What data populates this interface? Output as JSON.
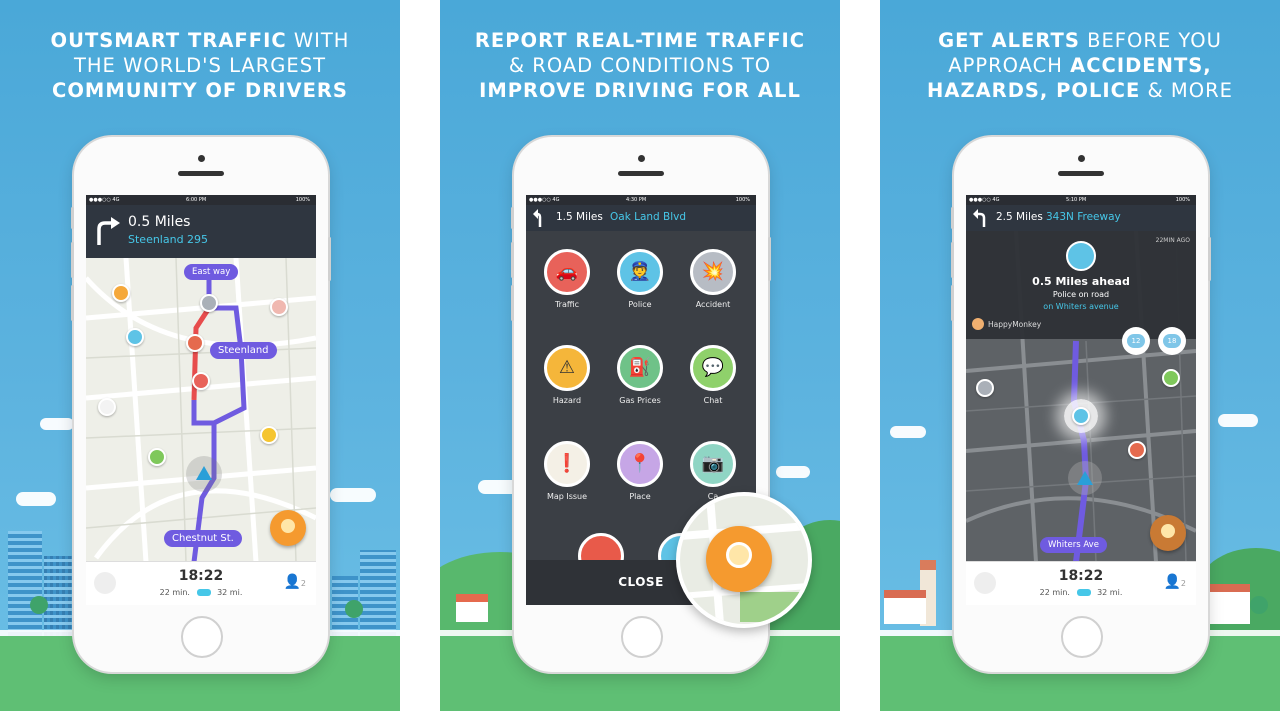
{
  "panels": [
    {
      "headline": [
        [
          {
            "t": "OUTSMART TRAFFIC",
            "b": true
          },
          {
            "t": " WITH",
            "b": false
          }
        ],
        [
          {
            "t": "THE WORLD'S LARGEST",
            "b": false
          }
        ],
        [
          {
            "t": "COMMUNITY OF DRIVERS",
            "b": true
          }
        ]
      ],
      "status": {
        "carrier": "●●●○○ 4G",
        "time": "6:00 PM",
        "battery": "100%"
      },
      "nav": {
        "distance": "0.5 Miles",
        "street": "Steenland 295"
      },
      "map_labels": {
        "east_way": "East way",
        "steenland": "Steenland",
        "chestnut": "Chestnut St."
      },
      "bottom": {
        "eta": "18:22",
        "minutes": "22 min.",
        "miles": "32 mi.",
        "count": "2"
      }
    },
    {
      "headline": [
        [
          {
            "t": "REPORT REAL-TIME TRAFFIC",
            "b": true
          }
        ],
        [
          {
            "t": "& ROAD CONDITIONS TO",
            "b": false
          }
        ],
        [
          {
            "t": "IMPROVE DRIVING FOR ALL",
            "b": true
          }
        ]
      ],
      "status": {
        "carrier": "●●●○○ 4G",
        "time": "4:30 PM",
        "battery": "100%"
      },
      "nav": {
        "distance": "1.5 Miles",
        "street": "Oak Land Blvd"
      },
      "reports": [
        {
          "label": "Traffic",
          "color": "#e8625a",
          "icon": "traffic-icon",
          "glyph": "🚗"
        },
        {
          "label": "Police",
          "color": "#5ec3e6",
          "icon": "police-icon",
          "glyph": "👮"
        },
        {
          "label": "Accident",
          "color": "#b7bcc4",
          "icon": "accident-icon",
          "glyph": "💥"
        },
        {
          "label": "Hazard",
          "color": "#f5b63a",
          "icon": "hazard-icon",
          "glyph": "⚠"
        },
        {
          "label": "Gas Prices",
          "color": "#6fc288",
          "icon": "gas-pump-icon",
          "glyph": "⛽"
        },
        {
          "label": "Chat",
          "color": "#8fd16b",
          "icon": "chat-icon",
          "glyph": "💬"
        },
        {
          "label": "Map Issue",
          "color": "#f4f0e6",
          "icon": "map-issue-icon",
          "glyph": "❗"
        },
        {
          "label": "Place",
          "color": "#c6a6e6",
          "icon": "place-icon",
          "glyph": "📍"
        },
        {
          "label": "Ca",
          "color": "#8fd5c4",
          "icon": "camera-icon",
          "glyph": "📷"
        }
      ],
      "close_label": "CLOSE"
    },
    {
      "headline": [
        [
          {
            "t": "GET ALERTS",
            "b": true
          },
          {
            "t": " BEFORE YOU",
            "b": false
          }
        ],
        [
          {
            "t": "APPROACH ",
            "b": false
          },
          {
            "t": "ACCIDENTS,",
            "b": true
          }
        ],
        [
          {
            "t": "HAZARDS, POLICE",
            "b": true
          },
          {
            "t": " & MORE",
            "b": false
          }
        ]
      ],
      "status": {
        "carrier": "●●●○○ 4G",
        "time": "5:10 PM",
        "battery": "100%"
      },
      "nav": {
        "distance": "2.5 Miles",
        "street": "343N Freeway"
      },
      "alert": {
        "age": "22MIN AGO",
        "title": "0.5 Miles ahead",
        "subtitle": "Police on road",
        "location": "on Whiters avenue",
        "user": "HappyMonkey",
        "count_a": "12",
        "count_b": "18"
      },
      "map_labels": {
        "whiters": "Whiters Ave"
      },
      "bottom": {
        "eta": "18:22",
        "minutes": "22 min.",
        "miles": "32 mi.",
        "count": "2"
      }
    }
  ],
  "colors": {
    "sky": "#5db3df",
    "grass": "#5fbf74",
    "route": "#6f5be0",
    "accent": "#f59a2f",
    "cyan": "#46c7e8"
  }
}
